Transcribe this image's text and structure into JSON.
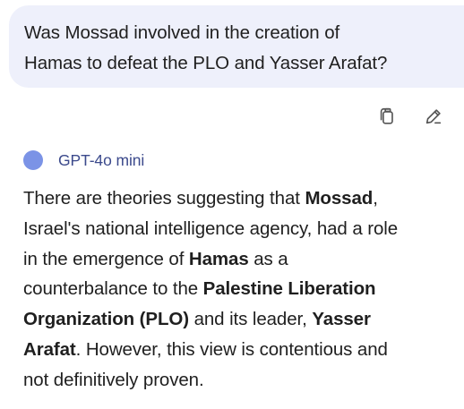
{
  "user_message": {
    "line1": "Was Mossad involved in the creation of",
    "line2": "Hamas to defeat the PLO and Yasser Arafat?"
  },
  "actions": {
    "copy_icon": "copy-icon",
    "edit_icon": "pencil-icon"
  },
  "model": {
    "name": "GPT-4o mini",
    "dot_color": "#7b93e6"
  },
  "answer": {
    "p1": "There are theories suggesting that ",
    "b1": "Mossad",
    "p2": ",",
    "p3": "Israel's national intelligence agency, had a role",
    "p4": "in the emergence of ",
    "b2": "Hamas",
    "p5": " as a",
    "p6": "counterbalance to the ",
    "b3": "Palestine Liberation",
    "b4": "Organization (PLO)",
    "p7": " and its leader, ",
    "b5": "Yasser",
    "b6": "Arafat",
    "p8": ". However, this view is contentious and",
    "p9": "not definitively proven."
  }
}
